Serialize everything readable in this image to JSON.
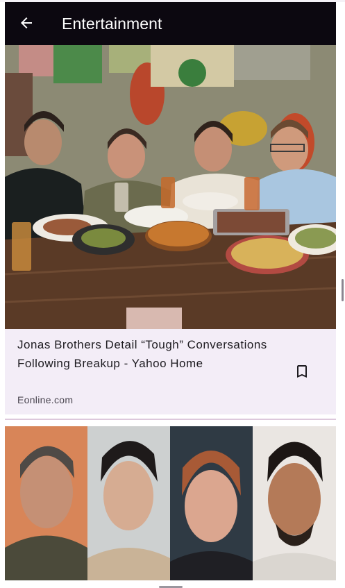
{
  "app_bar": {
    "title": "Entertainment",
    "back_icon": "arrow-back-icon"
  },
  "articles": [
    {
      "headline": "Jonas Brothers Detail “Tough” Conversations Following Breakup - Yahoo Home",
      "source": "Eonline.com",
      "image": "photo of four men seated at a wooden table with plates of food",
      "bookmark_icon": "bookmark-outline-icon"
    },
    {
      "image": "collage of four portrait photos",
      "headline": "",
      "source": ""
    }
  ],
  "colors": {
    "app_bar_bg": "#0c0810",
    "card_bg": "#f3edf7",
    "text_primary": "#1d1b20",
    "text_secondary": "#49454f",
    "divider": "#ddc8dc"
  }
}
